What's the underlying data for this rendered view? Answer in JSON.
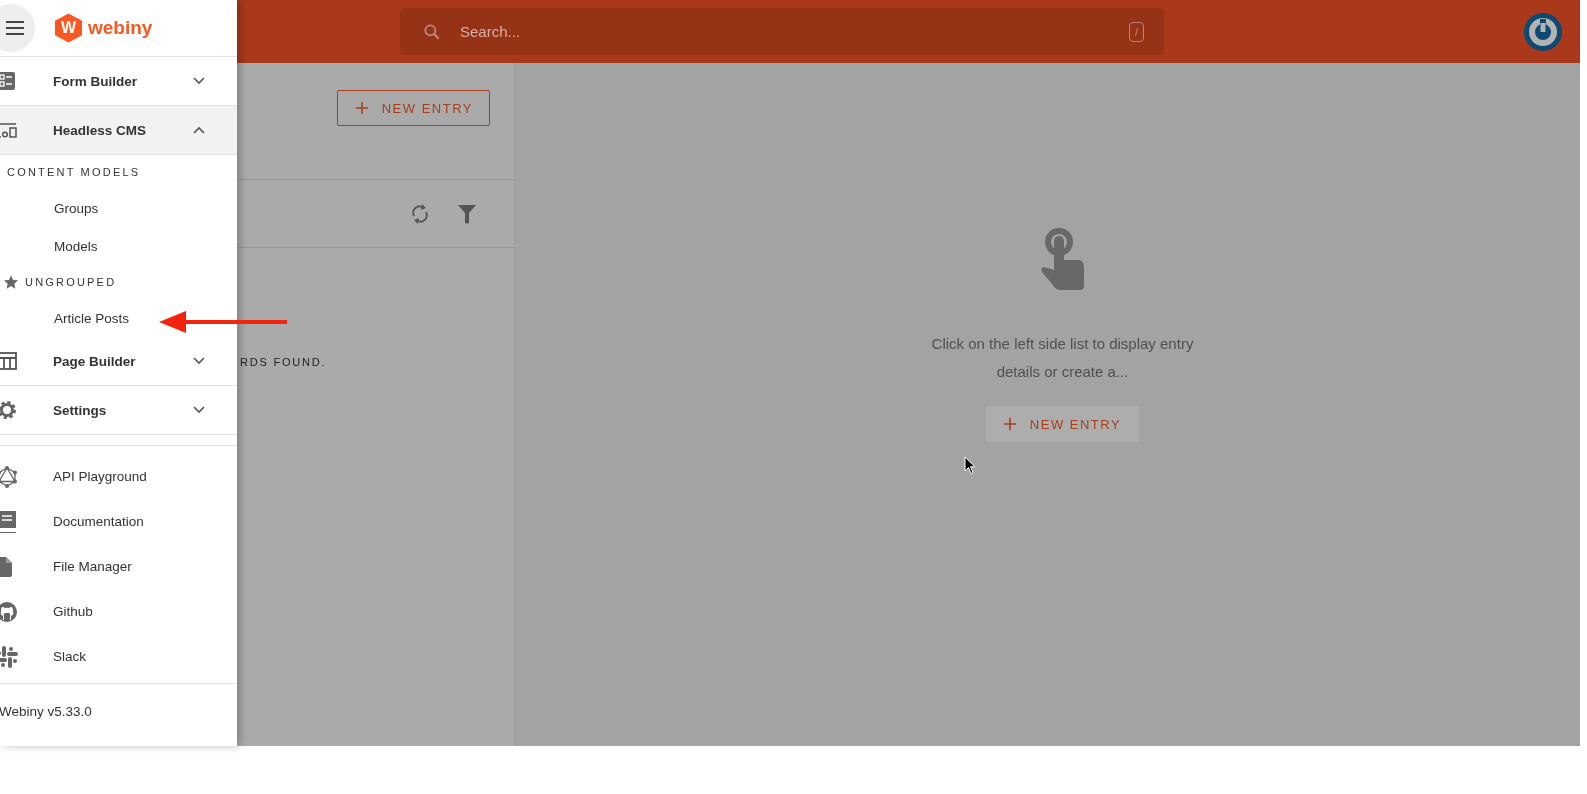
{
  "drawer": {
    "logo_mark": "W",
    "logo_text": "webiny",
    "nav": [
      {
        "label": "Form Builder",
        "expanded": false,
        "selected": false
      },
      {
        "label": "Headless CMS",
        "expanded": true,
        "selected": true,
        "children": [
          {
            "kind": "heading",
            "label": "CONTENT MODELS",
            "starred": false
          },
          {
            "kind": "link",
            "label": "Groups"
          },
          {
            "kind": "link",
            "label": "Models"
          },
          {
            "kind": "heading",
            "label": "UNGROUPED",
            "starred": true
          },
          {
            "kind": "link",
            "label": "Article Posts"
          }
        ]
      },
      {
        "label": "Page Builder",
        "expanded": false,
        "selected": false
      },
      {
        "label": "Settings",
        "expanded": false,
        "selected": false
      }
    ],
    "links": [
      {
        "label": "API Playground"
      },
      {
        "label": "Documentation"
      },
      {
        "label": "File Manager"
      },
      {
        "label": "Github"
      },
      {
        "label": "Slack"
      }
    ],
    "version": "Webiny v5.33.0"
  },
  "topbar": {
    "search": {
      "placeholder": "Search...",
      "shortcut": "/"
    }
  },
  "list_panel": {
    "new_entry_button": "NEW ENTRY",
    "empty_message": "RDS FOUND."
  },
  "detail_panel": {
    "message": "Click on the left side list to display entry details or create a...",
    "new_entry_button": "NEW ENTRY"
  }
}
